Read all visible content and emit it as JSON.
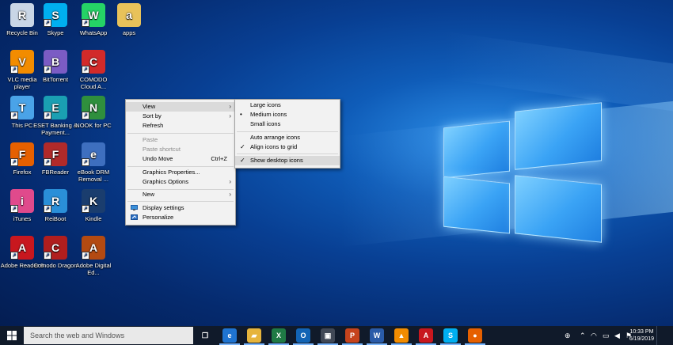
{
  "desktop": {
    "icons": [
      {
        "label": "Recycle Bin",
        "icon": "recycle-bin-icon",
        "color": "#c9d6e6"
      },
      {
        "label": "Skype",
        "icon": "skype-icon",
        "color": "#00aff0"
      },
      {
        "label": "WhatsApp",
        "icon": "whatsapp-icon",
        "color": "#25d366"
      },
      {
        "label": "apps",
        "icon": "folder-icon",
        "color": "#e8c25a"
      },
      {
        "label": "VLC media player",
        "icon": "vlc-icon",
        "color": "#f28c00"
      },
      {
        "label": "BitTorrent",
        "icon": "bittorrent-icon",
        "color": "#7b5cc4"
      },
      {
        "label": "COMODO Cloud A...",
        "icon": "comodo-cloud-icon",
        "color": "#d22a2a"
      },
      {
        "label": "This PC",
        "icon": "this-pc-icon",
        "color": "#4aa3e8"
      },
      {
        "label": "ESET Banking & Payment...",
        "icon": "eset-icon",
        "color": "#1a9fb2"
      },
      {
        "label": "NOOK for PC",
        "icon": "nook-icon",
        "color": "#2f8f3d"
      },
      {
        "label": "Firefox",
        "icon": "firefox-icon",
        "color": "#e66000"
      },
      {
        "label": "FBReader",
        "icon": "fbreader-icon",
        "color": "#b02a2a"
      },
      {
        "label": "eBook DRM Removal ...",
        "icon": "ebook-drm-icon",
        "color": "#3e6fbf"
      },
      {
        "label": "iTunes",
        "icon": "itunes-icon",
        "color": "#e04a8c"
      },
      {
        "label": "ReiBoot",
        "icon": "reiboot-icon",
        "color": "#2a8fd8"
      },
      {
        "label": "Kindle",
        "icon": "kindle-icon",
        "color": "#1a3d6e"
      },
      {
        "label": "Adobe Reader 9",
        "icon": "adobe-reader-icon",
        "color": "#c8171e"
      },
      {
        "label": "Comodo Dragon",
        "icon": "comodo-dragon-icon",
        "color": "#b01e1e"
      },
      {
        "label": "Adobe Digital Ed...",
        "icon": "adobe-digital-editions-icon",
        "color": "#b34a12"
      }
    ]
  },
  "context_menu": {
    "items": [
      {
        "label": "View",
        "submenu": true
      },
      {
        "label": "Sort by",
        "submenu": true
      },
      {
        "label": "Refresh"
      },
      {
        "label": "Paste",
        "disabled": true
      },
      {
        "label": "Paste shortcut",
        "disabled": true
      },
      {
        "label": "Undo Move",
        "shortcut": "Ctrl+Z"
      },
      {
        "label": "Graphics Properties..."
      },
      {
        "label": "Graphics Options",
        "submenu": true
      },
      {
        "label": "New",
        "submenu": true
      },
      {
        "label": "Display settings"
      },
      {
        "label": "Personalize"
      }
    ]
  },
  "view_submenu": {
    "items": [
      {
        "label": "Large icons"
      },
      {
        "label": "Medium icons",
        "mark": "•"
      },
      {
        "label": "Small icons"
      },
      {
        "label": "Auto arrange icons"
      },
      {
        "label": "Align icons to grid",
        "mark": "✓"
      },
      {
        "label": "Show desktop icons",
        "mark": "✓"
      }
    ]
  },
  "taskbar": {
    "search_placeholder": "Search the web and Windows",
    "apps": [
      {
        "name": "task-view",
        "glyph": "❐",
        "color": "#101a2a"
      },
      {
        "name": "edge",
        "glyph": "e",
        "color": "#1f74d1"
      },
      {
        "name": "file-explorer",
        "glyph": "▰",
        "color": "#e6b43c"
      },
      {
        "name": "excel",
        "glyph": "X",
        "color": "#1f7a45"
      },
      {
        "name": "outlook",
        "glyph": "O",
        "color": "#1264b5"
      },
      {
        "name": "store",
        "glyph": "▣",
        "color": "#404856"
      },
      {
        "name": "powerpoint",
        "glyph": "P",
        "color": "#c6431c"
      },
      {
        "name": "word",
        "glyph": "W",
        "color": "#2a5ba8"
      },
      {
        "name": "vlc",
        "glyph": "▲",
        "color": "#f28c00"
      },
      {
        "name": "adobe-reader",
        "glyph": "A",
        "color": "#c8171e"
      },
      {
        "name": "skype",
        "glyph": "S",
        "color": "#00aff0"
      },
      {
        "name": "firefox",
        "glyph": "●",
        "color": "#e66000"
      }
    ],
    "time": "10:33 PM",
    "date": "6/19/2019"
  }
}
